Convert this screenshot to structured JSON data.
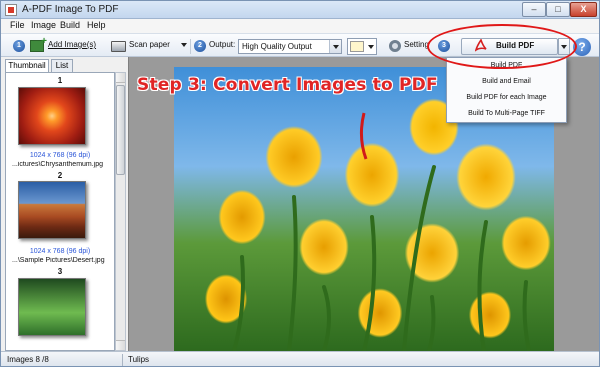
{
  "window": {
    "title": "A-PDF Image To PDF",
    "controls": {
      "minimize": "–",
      "maximize": "□",
      "close": "X"
    }
  },
  "menu": [
    "File",
    "Image",
    "Build",
    "Help"
  ],
  "toolbar": {
    "step1": "1",
    "add_images": "Add Image(s)",
    "scan_paper": "Scan paper",
    "step2": "2",
    "output_label": "Output:",
    "output_value": "High Quality Output",
    "setting": "Setting",
    "step3": "3",
    "build_pdf": "Build PDF",
    "help": "?",
    "swatch_color": "#fff6cc"
  },
  "tabs": {
    "thumbnail": "Thumbnail",
    "list": "List"
  },
  "thumbnails": [
    {
      "number": "1",
      "dims": "",
      "path": "",
      "thumb": "img-flower"
    },
    {
      "number": "2",
      "dims": "1024 x 768 (96 dpi)",
      "path": "...ictures\\Chrysanthemum.jpg",
      "thumb": "img-desert"
    },
    {
      "number": "3",
      "dims": "1024 x 768 (96 dpi)",
      "path": "...\\Sample Pictures\\Desert.jpg",
      "thumb": "img-green"
    }
  ],
  "preview": {
    "annotation": "Step 3: Convert Images to PDF",
    "annotation_color": "#e02525"
  },
  "build_menu": [
    "Build PDF",
    "Build and Email",
    "Build PDF for each Image",
    "Build To Multi-Page TIFF"
  ],
  "status": {
    "images": "Images 8 /8",
    "current": "Tulips"
  }
}
